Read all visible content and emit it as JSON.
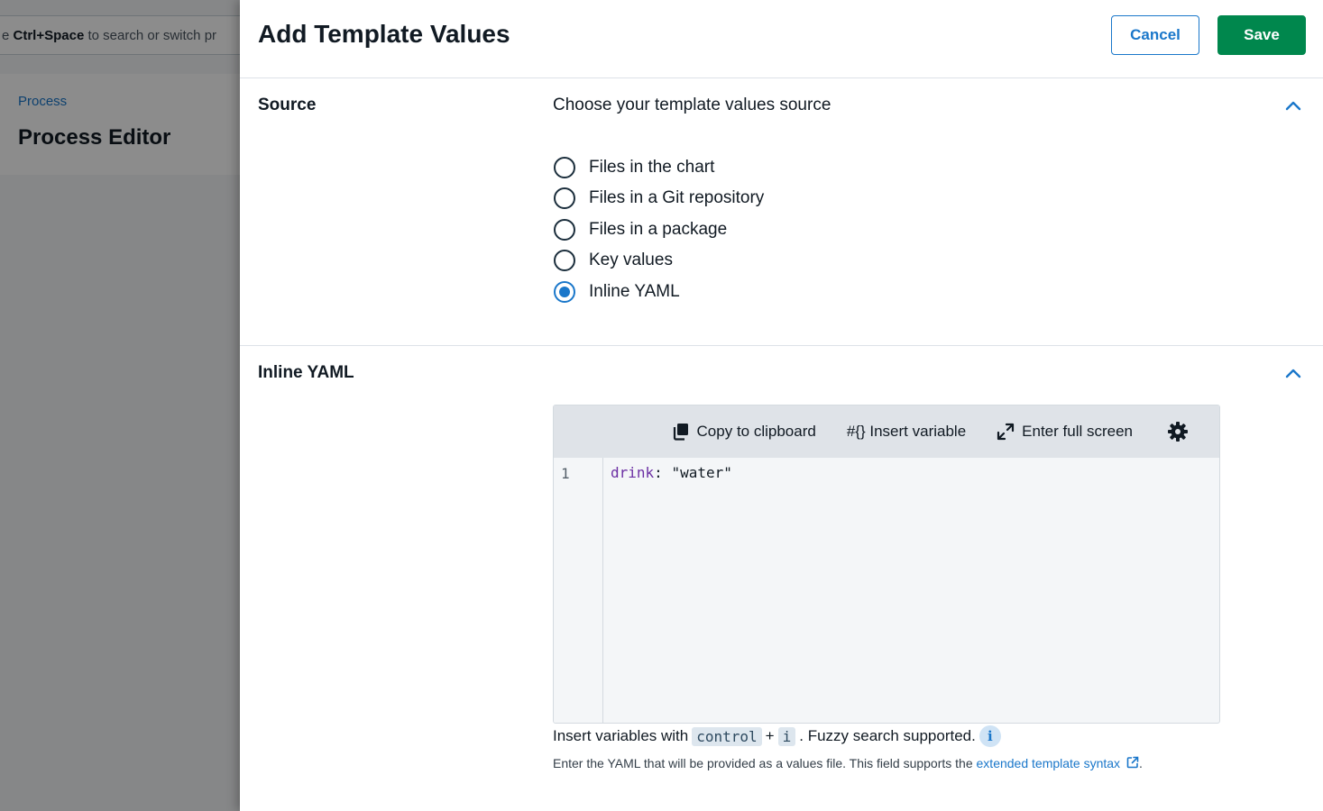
{
  "background": {
    "search_prefix": "e ",
    "search_shortcut": "Ctrl+Space",
    "search_suffix": " to search or switch pr",
    "breadcrumb": "Process",
    "page_title": "Process Editor"
  },
  "drawer": {
    "title": "Add Template Values",
    "cancel_label": "Cancel",
    "save_label": "Save"
  },
  "source_section": {
    "label": "Source",
    "description": "Choose your template values source",
    "options": [
      {
        "label": "Files in the chart",
        "checked": false
      },
      {
        "label": "Files in a Git repository",
        "checked": false
      },
      {
        "label": "Files in a package",
        "checked": false
      },
      {
        "label": "Key values",
        "checked": false
      },
      {
        "label": "Inline YAML",
        "checked": true
      }
    ]
  },
  "yaml_section": {
    "label": "Inline YAML",
    "toolbar": {
      "copy_label": "Copy to clipboard",
      "insert_label": "#{} Insert variable",
      "fullscreen_label": "Enter full screen"
    },
    "editor": {
      "line_number": "1",
      "key": "drink",
      "separator": ": ",
      "value": "\"water\""
    },
    "hint": {
      "prefix": "Insert variables with",
      "key1": "control",
      "plus": "+",
      "key2": "i",
      "suffix": ".  Fuzzy search supported."
    },
    "help": {
      "text": "Enter the YAML that will be provided as a values file. This field supports the ",
      "link": "extended template syntax",
      "end": "."
    }
  },
  "colors": {
    "accent": "#1a77ca",
    "save": "#00874d"
  }
}
